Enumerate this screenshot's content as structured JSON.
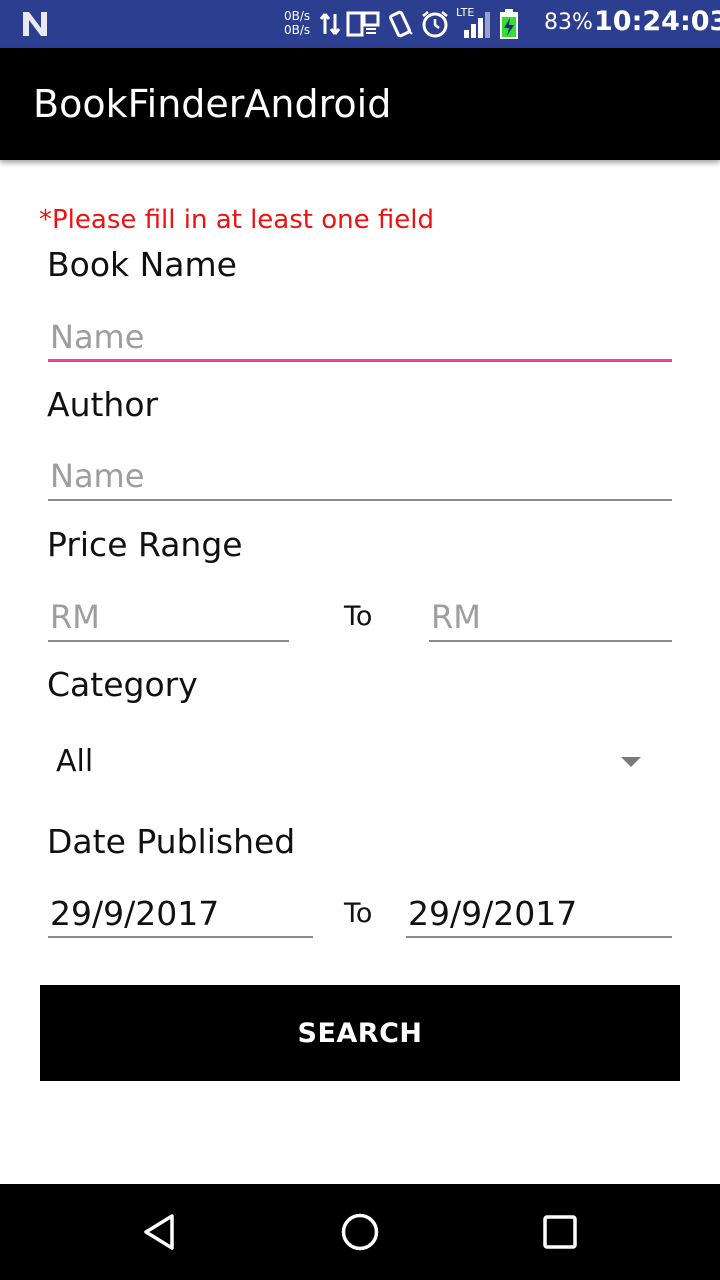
{
  "status_bar": {
    "net_up": "0B/s",
    "net_down": "0B/s",
    "network_type": "LTE",
    "battery_percent": "83%",
    "time": "10:24:03",
    "bg_color": "#2c3e8f"
  },
  "app_bar": {
    "title": "BookFinderAndroid"
  },
  "form": {
    "warning": "*Please fill in at least one field",
    "book_name": {
      "label": "Book Name",
      "placeholder": "Name",
      "value": ""
    },
    "author": {
      "label": "Author",
      "placeholder": "Name",
      "value": ""
    },
    "price_range": {
      "label": "Price Range",
      "min_placeholder": "RM",
      "to_label": "To",
      "max_placeholder": "RM"
    },
    "category": {
      "label": "Category",
      "selected": "All"
    },
    "date_published": {
      "label": "Date Published",
      "from": "29/9/2017",
      "to_label": "To",
      "to": "29/9/2017"
    },
    "search_button": "SEARCH"
  },
  "colors": {
    "accent_focus": "#e84887",
    "warning_text": "#ee1111"
  },
  "icons": {
    "status": [
      "notification-n-icon",
      "data-transfer-icon",
      "cast-icon",
      "vibrate-icon",
      "alarm-icon",
      "signal-icon",
      "battery-charging-icon"
    ],
    "nav": [
      "back-icon",
      "home-icon",
      "recents-icon"
    ]
  }
}
